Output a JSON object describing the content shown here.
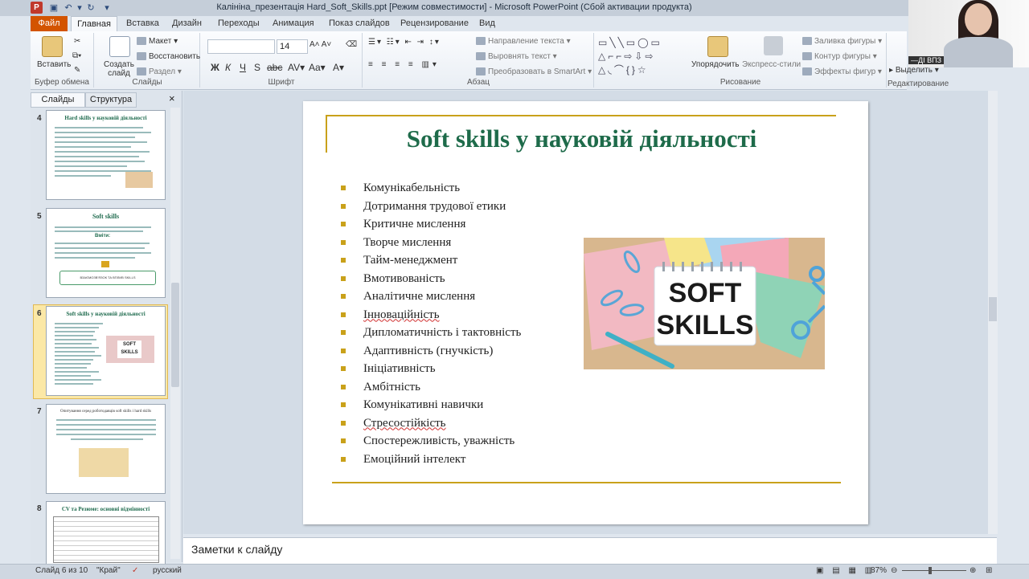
{
  "window": {
    "title": "Калініна_презентація Hard_Soft_Skills.ppt [Режим совместимости] - Microsoft PowerPoint (Сбой активации продукта)"
  },
  "tabs": {
    "file": "Файл",
    "items": [
      "Главная",
      "Вставка",
      "Дизайн",
      "Переходы",
      "Анимация",
      "Показ слайдов",
      "Рецензирование",
      "Вид"
    ]
  },
  "ribbon": {
    "clipboard": {
      "paste": "Вставить",
      "group": "Буфер обмена"
    },
    "slides": {
      "new_slide": "Создать слайд",
      "layout": "Макет",
      "reset": "Восстановить",
      "section": "Раздел",
      "group": "Слайды"
    },
    "font": {
      "font_name": "",
      "font_size": "14",
      "group": "Шрифт"
    },
    "paragraph": {
      "text_direction": "Направление текста",
      "align_text": "Выровнять текст",
      "smartart": "Преобразовать в SmartArt",
      "group": "Абзац"
    },
    "drawing": {
      "arrange": "Упорядочить",
      "quick_styles": "Экспресс-стили",
      "fill": "Заливка фигуры",
      "outline": "Контур фигуры",
      "effects": "Эффекты фигур",
      "group": "Рисование"
    },
    "editing": {
      "select": "Выделить",
      "group": "Редактирование"
    }
  },
  "video": {
    "label": "—ДІ ВПЗ"
  },
  "panel": {
    "tab_slides": "Слайды",
    "tab_outline": "Структура",
    "close": "×",
    "thumbnails": [
      {
        "num": "4",
        "title": "Hard skills у науковій діяльності"
      },
      {
        "num": "5",
        "title": "Soft skills",
        "subtitle": "Вміти:",
        "box": "ВЗАЄМОЗВ'ЯЗОК   ТА   ВПЛИВ   SKILLS"
      },
      {
        "num": "6",
        "title": "Soft skills у науковій діяльності",
        "badge": "SOFT SKILLS"
      },
      {
        "num": "7",
        "title": "Опитування серед роботодавців soft skills і hard skills"
      },
      {
        "num": "8",
        "title": "CV та Резюме: основні відмінності"
      }
    ]
  },
  "slide": {
    "title": "Soft skills у науковій діяльності",
    "bullets": [
      "Комунікабельність",
      "Дотримання трудової етики",
      "Критичне мислення",
      "Творче мислення",
      "Тайм-менеджмент",
      "Вмотивованість",
      "Аналітичне  мислення",
      "Інноваційність",
      "Дипломатичність і тактовність",
      "Адаптивність (гнучкість)",
      "Ініціативність",
      "Амбітність",
      "Комунікативні навички",
      "Стресостійкість",
      "Спостережливість, уважність",
      "Емоційний інтелект"
    ],
    "image_text_line1": "SOFT",
    "image_text_line2": "SKILLS"
  },
  "notes": {
    "placeholder": "Заметки к слайду"
  },
  "status": {
    "slide_info": "Слайд 6 из 10",
    "theme": "\"Край\"",
    "language": "русский",
    "zoom": "87%"
  }
}
